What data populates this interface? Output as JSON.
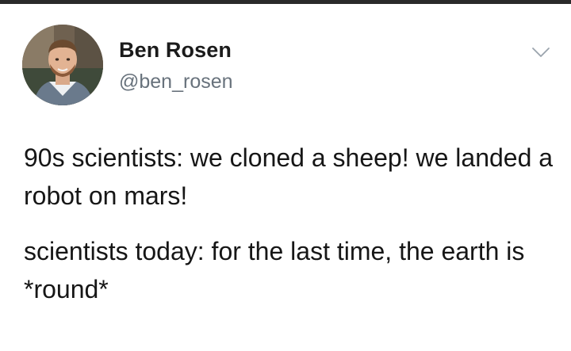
{
  "tweet": {
    "author": {
      "display_name": "Ben Rosen",
      "handle": "@ben_rosen",
      "avatar_icon": "profile-photo"
    },
    "menu_icon": "chevron-down-icon",
    "text": {
      "paragraph_1": "90s scientists: we cloned a sheep! we landed a robot on mars!",
      "paragraph_2": "scientists today: for the last time, the earth is *round*"
    }
  },
  "colors": {
    "name": "#1b1b1b",
    "handle": "#68727c",
    "body_text": "#161616",
    "chevron": "#9aa4ad",
    "top_border": "#2a2a2a"
  }
}
